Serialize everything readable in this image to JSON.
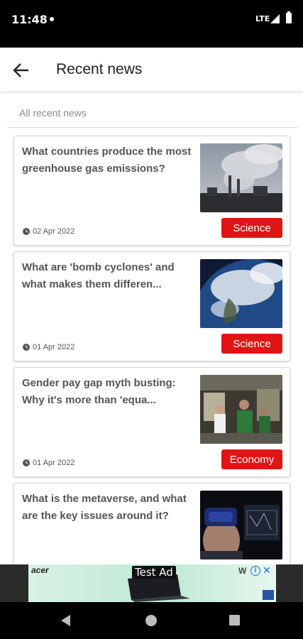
{
  "status_bar": {
    "time": "11:48",
    "network": "LTE"
  },
  "header": {
    "title": "Recent news"
  },
  "section": {
    "label": "All recent news"
  },
  "articles": [
    {
      "headline": "What countries produce the most greenhouse gas emissions?",
      "date": "02 Apr 2022",
      "category": "Science",
      "image": "factory-smoke-image"
    },
    {
      "headline": "What are 'bomb cyclones' and what makes them differen...",
      "date": "01 Apr 2022",
      "category": "Science",
      "image": "earth-clouds-image"
    },
    {
      "headline": "Gender pay gap myth busting: Why it's more than 'equa...",
      "date": "01 Apr 2022",
      "category": "Economy",
      "image": "office-workers-image"
    },
    {
      "headline": "What is the metaverse, and what are the key issues around it?",
      "date": "",
      "category": "",
      "image": "vr-headset-image"
    }
  ],
  "ad": {
    "label": "Test Ad",
    "brand": "acer"
  },
  "colors": {
    "tag": "#e01414",
    "status_bar": "#000000",
    "nav_bar": "#000000"
  }
}
